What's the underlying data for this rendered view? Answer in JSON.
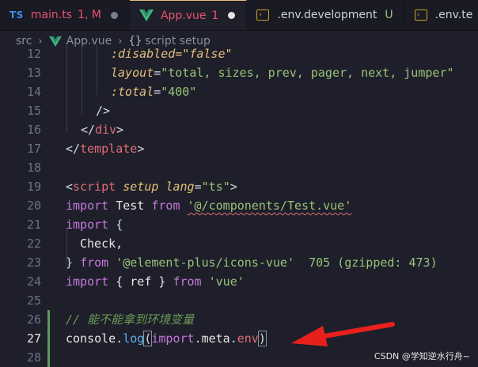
{
  "tabs": [
    {
      "icon": "TS",
      "name": "main.ts",
      "status": "1, M",
      "indicator": "modified-dot"
    },
    {
      "icon": "vue",
      "name": "App.vue",
      "status": "1",
      "indicator": "unsaved-dot"
    },
    {
      "icon": "env",
      "name": ".env.development",
      "status": "U"
    },
    {
      "icon": "env",
      "name": ".env.te"
    }
  ],
  "breadcrumb": {
    "folder": "src",
    "file": "App.vue",
    "braces": "{}",
    "symbol": "script setup"
  },
  "code": {
    "lines": [
      {
        "num": "12",
        "tokens": [
          ":disabled=\"false\""
        ]
      },
      {
        "num": "13",
        "tokens": [
          "layout",
          "=",
          "\"total, sizes, prev, pager, next, jumper\""
        ]
      },
      {
        "num": "14",
        "tokens": [
          ":total",
          "=",
          "\"400\""
        ]
      },
      {
        "num": "15",
        "tokens": [
          "/>"
        ]
      },
      {
        "num": "16",
        "tokens": [
          "</",
          "div",
          ">"
        ]
      },
      {
        "num": "17",
        "tokens": [
          "</",
          "template",
          ">"
        ]
      },
      {
        "num": "18",
        "tokens": []
      },
      {
        "num": "19",
        "tokens": [
          "<",
          "script",
          "setup",
          "lang",
          "=",
          "\"ts\"",
          ">"
        ]
      },
      {
        "num": "20",
        "tokens": [
          "import",
          "Test",
          "from",
          "'@/components/Test.vue'"
        ]
      },
      {
        "num": "21",
        "tokens": [
          "import",
          "{"
        ]
      },
      {
        "num": "22",
        "tokens": [
          "Check,"
        ]
      },
      {
        "num": "23",
        "tokens": [
          "}",
          "from",
          "'@element-plus/icons-vue'",
          "705 (gzipped: 473)"
        ]
      },
      {
        "num": "24",
        "tokens": [
          "import",
          "{ ref }",
          "from",
          "'vue'"
        ]
      },
      {
        "num": "25",
        "tokens": []
      },
      {
        "num": "26",
        "tokens": [
          "// 能不能拿到环境变量"
        ]
      },
      {
        "num": "27",
        "tokens": [
          "console",
          ".",
          "log",
          "(",
          "import",
          ".",
          "meta",
          ".",
          "env",
          ")"
        ]
      },
      {
        "num": "28",
        "tokens": []
      }
    ],
    "current_line": "27"
  },
  "watermark": "CSDN @学知逆水行舟~",
  "colors": {
    "background": "#1e1f2a",
    "error_tab": "#e8546c",
    "string": "#98c379",
    "keyword": "#c678dd",
    "tag": "#e06c75",
    "attribute": "#e5c07b",
    "arrow": "#e8201c"
  },
  "annotation": {
    "icon": "red-arrow-icon"
  }
}
